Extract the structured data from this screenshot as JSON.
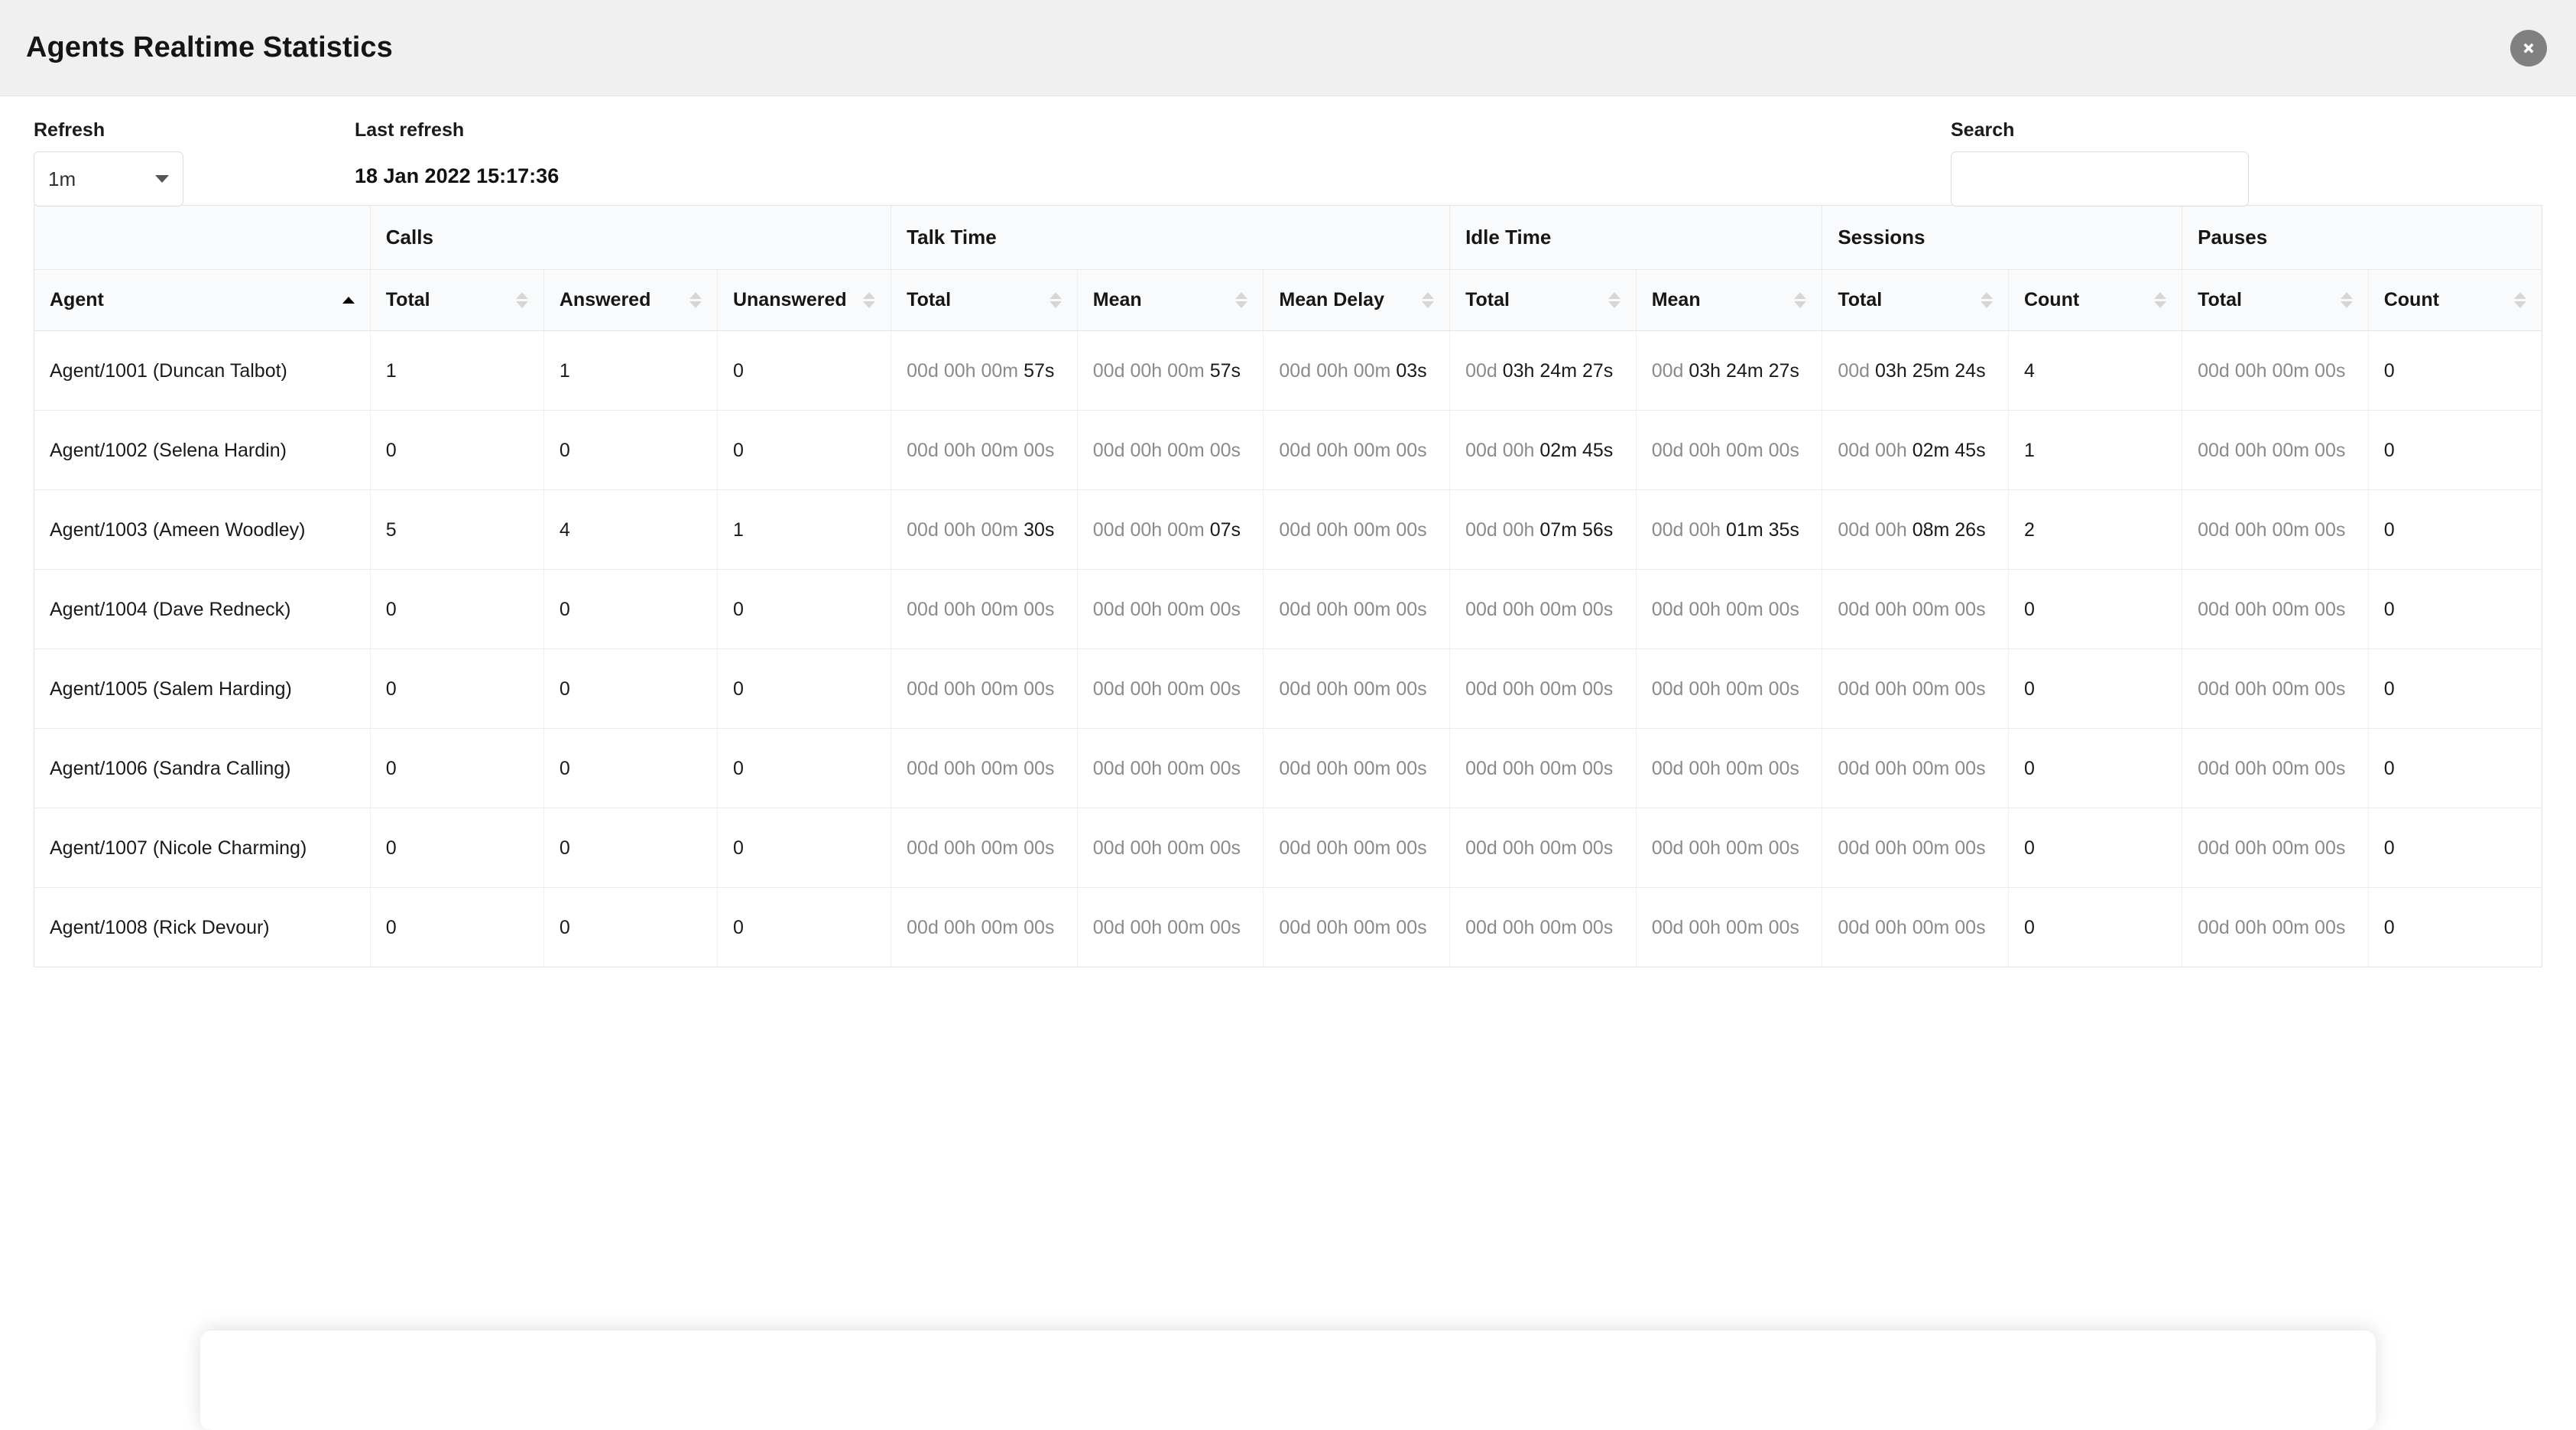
{
  "window": {
    "title": "Agents Realtime Statistics",
    "close_icon": "close-circle-icon"
  },
  "controls": {
    "refresh": {
      "label": "Refresh",
      "selected": "1m",
      "caret_icon": "chevron-down-icon"
    },
    "last_refresh": {
      "label": "Last refresh",
      "value": "18 Jan 2022 15:17:36"
    },
    "search": {
      "label": "Search",
      "value": "",
      "placeholder": ""
    }
  },
  "table": {
    "group_headers": [
      {
        "label": "",
        "span": 1
      },
      {
        "label": "Calls",
        "span": 3
      },
      {
        "label": "Talk Time",
        "span": 3
      },
      {
        "label": "Idle Time",
        "span": 2
      },
      {
        "label": "Sessions",
        "span": 2
      },
      {
        "label": "Pauses",
        "span": 2
      }
    ],
    "columns": [
      {
        "label": "Agent",
        "sort": "asc",
        "type": "text"
      },
      {
        "label": "Total",
        "sort": "none",
        "type": "num"
      },
      {
        "label": "Answered",
        "sort": "none",
        "type": "num"
      },
      {
        "label": "Unanswered",
        "sort": "none",
        "type": "num"
      },
      {
        "label": "Total",
        "sort": "none",
        "type": "duration"
      },
      {
        "label": "Mean",
        "sort": "none",
        "type": "duration"
      },
      {
        "label": "Mean Delay",
        "sort": "none",
        "type": "duration"
      },
      {
        "label": "Total",
        "sort": "none",
        "type": "duration"
      },
      {
        "label": "Mean",
        "sort": "none",
        "type": "duration"
      },
      {
        "label": "Total",
        "sort": "none",
        "type": "duration"
      },
      {
        "label": "Count",
        "sort": "none",
        "type": "num"
      },
      {
        "label": "Total",
        "sort": "none",
        "type": "duration"
      },
      {
        "label": "Count",
        "sort": "none",
        "type": "num"
      }
    ],
    "rows": [
      {
        "agent": "Agent/1001 (Duncan Talbot)",
        "calls_total": "1",
        "calls_answered": "1",
        "calls_unanswered": "0",
        "talk_total": "00d 00h 00m 57s",
        "talk_mean": "00d 00h 00m 57s",
        "talk_mean_delay": "00d 00h 00m 03s",
        "idle_total": "00d 03h 24m 27s",
        "idle_mean": "00d 03h 24m 27s",
        "sessions_total": "00d 03h 25m 24s",
        "sessions_count": "4",
        "pauses_total": "00d 00h 00m 00s",
        "pauses_count": "0"
      },
      {
        "agent": "Agent/1002 (Selena Hardin)",
        "calls_total": "0",
        "calls_answered": "0",
        "calls_unanswered": "0",
        "talk_total": "00d 00h 00m 00s",
        "talk_mean": "00d 00h 00m 00s",
        "talk_mean_delay": "00d 00h 00m 00s",
        "idle_total": "00d 00h 02m 45s",
        "idle_mean": "00d 00h 00m 00s",
        "sessions_total": "00d 00h 02m 45s",
        "sessions_count": "1",
        "pauses_total": "00d 00h 00m 00s",
        "pauses_count": "0"
      },
      {
        "agent": "Agent/1003 (Ameen Woodley)",
        "calls_total": "5",
        "calls_answered": "4",
        "calls_unanswered": "1",
        "talk_total": "00d 00h 00m 30s",
        "talk_mean": "00d 00h 00m 07s",
        "talk_mean_delay": "00d 00h 00m 00s",
        "idle_total": "00d 00h 07m 56s",
        "idle_mean": "00d 00h 01m 35s",
        "sessions_total": "00d 00h 08m 26s",
        "sessions_count": "2",
        "pauses_total": "00d 00h 00m 00s",
        "pauses_count": "0"
      },
      {
        "agent": "Agent/1004 (Dave Redneck)",
        "calls_total": "0",
        "calls_answered": "0",
        "calls_unanswered": "0",
        "talk_total": "00d 00h 00m 00s",
        "talk_mean": "00d 00h 00m 00s",
        "talk_mean_delay": "00d 00h 00m 00s",
        "idle_total": "00d 00h 00m 00s",
        "idle_mean": "00d 00h 00m 00s",
        "sessions_total": "00d 00h 00m 00s",
        "sessions_count": "0",
        "pauses_total": "00d 00h 00m 00s",
        "pauses_count": "0"
      },
      {
        "agent": "Agent/1005 (Salem Harding)",
        "calls_total": "0",
        "calls_answered": "0",
        "calls_unanswered": "0",
        "talk_total": "00d 00h 00m 00s",
        "talk_mean": "00d 00h 00m 00s",
        "talk_mean_delay": "00d 00h 00m 00s",
        "idle_total": "00d 00h 00m 00s",
        "idle_mean": "00d 00h 00m 00s",
        "sessions_total": "00d 00h 00m 00s",
        "sessions_count": "0",
        "pauses_total": "00d 00h 00m 00s",
        "pauses_count": "0"
      },
      {
        "agent": "Agent/1006 (Sandra Calling)",
        "calls_total": "0",
        "calls_answered": "0",
        "calls_unanswered": "0",
        "talk_total": "00d 00h 00m 00s",
        "talk_mean": "00d 00h 00m 00s",
        "talk_mean_delay": "00d 00h 00m 00s",
        "idle_total": "00d 00h 00m 00s",
        "idle_mean": "00d 00h 00m 00s",
        "sessions_total": "00d 00h 00m 00s",
        "sessions_count": "0",
        "pauses_total": "00d 00h 00m 00s",
        "pauses_count": "0"
      },
      {
        "agent": "Agent/1007 (Nicole Charming)",
        "calls_total": "0",
        "calls_answered": "0",
        "calls_unanswered": "0",
        "talk_total": "00d 00h 00m 00s",
        "talk_mean": "00d 00h 00m 00s",
        "talk_mean_delay": "00d 00h 00m 00s",
        "idle_total": "00d 00h 00m 00s",
        "idle_mean": "00d 00h 00m 00s",
        "sessions_total": "00d 00h 00m 00s",
        "sessions_count": "0",
        "pauses_total": "00d 00h 00m 00s",
        "pauses_count": "0"
      },
      {
        "agent": "Agent/1008 (Rick Devour)",
        "calls_total": "0",
        "calls_answered": "0",
        "calls_unanswered": "0",
        "talk_total": "00d 00h 00m 00s",
        "talk_mean": "00d 00h 00m 00s",
        "talk_mean_delay": "00d 00h 00m 00s",
        "idle_total": "00d 00h 00m 00s",
        "idle_mean": "00d 00h 00m 00s",
        "sessions_total": "00d 00h 00m 00s",
        "sessions_count": "0",
        "pauses_total": "00d 00h 00m 00s",
        "pauses_count": "0"
      }
    ],
    "row_field_order": [
      "agent",
      "calls_total",
      "calls_answered",
      "calls_unanswered",
      "talk_total",
      "talk_mean",
      "talk_mean_delay",
      "idle_total",
      "idle_mean",
      "sessions_total",
      "sessions_count",
      "pauses_total",
      "pauses_count"
    ]
  },
  "colors": {
    "titlebar_bg": "#f0f0f0",
    "header_bg": "#f9fafb",
    "border": "#e4e4e4",
    "dim_text": "#8b8b8b",
    "text": "#1a1a1a",
    "close_circle": "#808080"
  }
}
